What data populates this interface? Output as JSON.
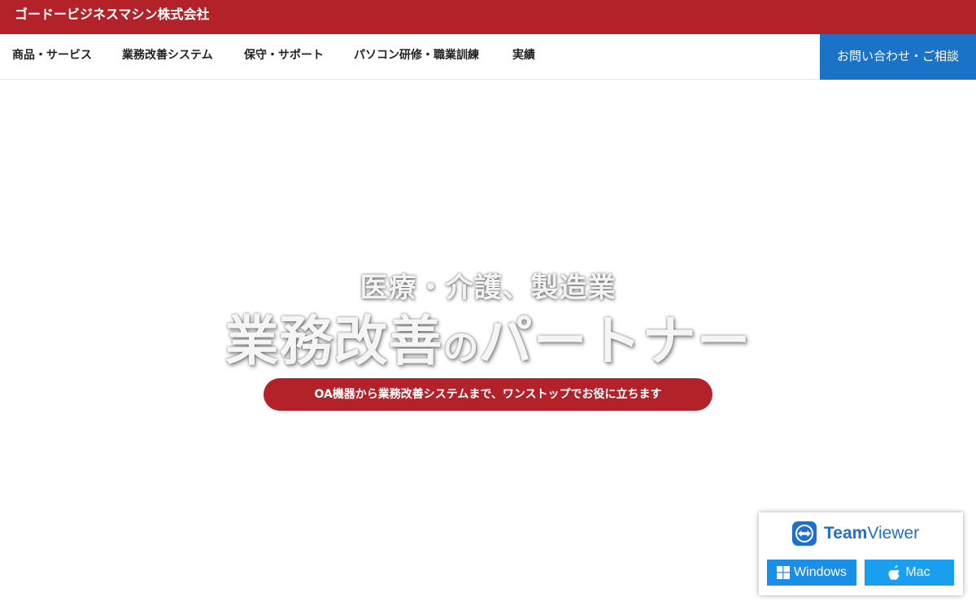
{
  "header": {
    "logo_text": "ゴードービジネスマシン株式会社",
    "brand_color": "#b22228"
  },
  "nav": {
    "items": [
      {
        "label": "商品・サービス"
      },
      {
        "label": "業務改善システム"
      },
      {
        "label": "保守・サポート"
      },
      {
        "label": "パソコン研修・職業訓練"
      },
      {
        "label": "実績"
      }
    ],
    "cta_label": "お問い合わせ・ご相談",
    "cta_color": "#1b73c8"
  },
  "hero": {
    "subtitle": "医療・介護、製造業",
    "title_main": "業務改善",
    "title_particle": "の",
    "title_end": "パートナー",
    "pill_text": "OA機器から業務改善システムまで、ワンストップでお役に立ちます"
  },
  "teamviewer": {
    "brand_team": "Team",
    "brand_viewer": "Viewer",
    "windows_label": "Windows",
    "mac_label": "Mac",
    "icons": [
      "teamviewer-icon",
      "windows-icon",
      "apple-icon"
    ]
  }
}
